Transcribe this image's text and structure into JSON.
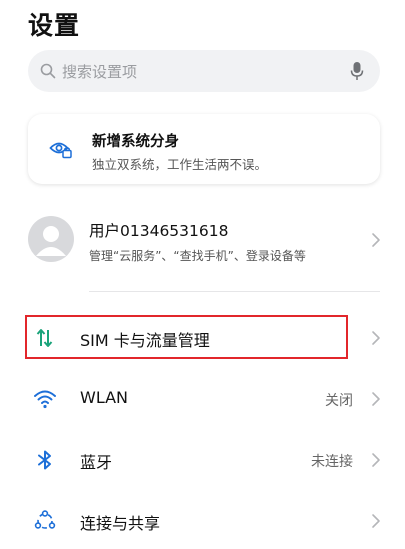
{
  "header": {
    "title": "设置"
  },
  "search": {
    "placeholder": "搜索设置项"
  },
  "promo": {
    "title": "新增系统分身",
    "subtitle": "独立双系统，工作生活两不误。",
    "icon": "dual-system-eye-icon"
  },
  "account": {
    "name": "用户01346531618",
    "description": "管理“云服务”、“查找手机”、登录设备等"
  },
  "settings": [
    {
      "label": "SIM 卡与流量管理",
      "value": "",
      "icon": "sim-data-icon",
      "highlighted": true
    },
    {
      "label": "WLAN",
      "value": "关闭",
      "icon": "wifi-icon"
    },
    {
      "label": "蓝牙",
      "value": "未连接",
      "icon": "bluetooth-icon"
    },
    {
      "label": "连接与共享",
      "value": "",
      "icon": "connection-share-icon"
    }
  ],
  "colors": {
    "accent": "#1d6fd8",
    "sim_icon": "#1aa37a",
    "highlight": "#e2262b",
    "search_bg": "#f1f2f4"
  }
}
